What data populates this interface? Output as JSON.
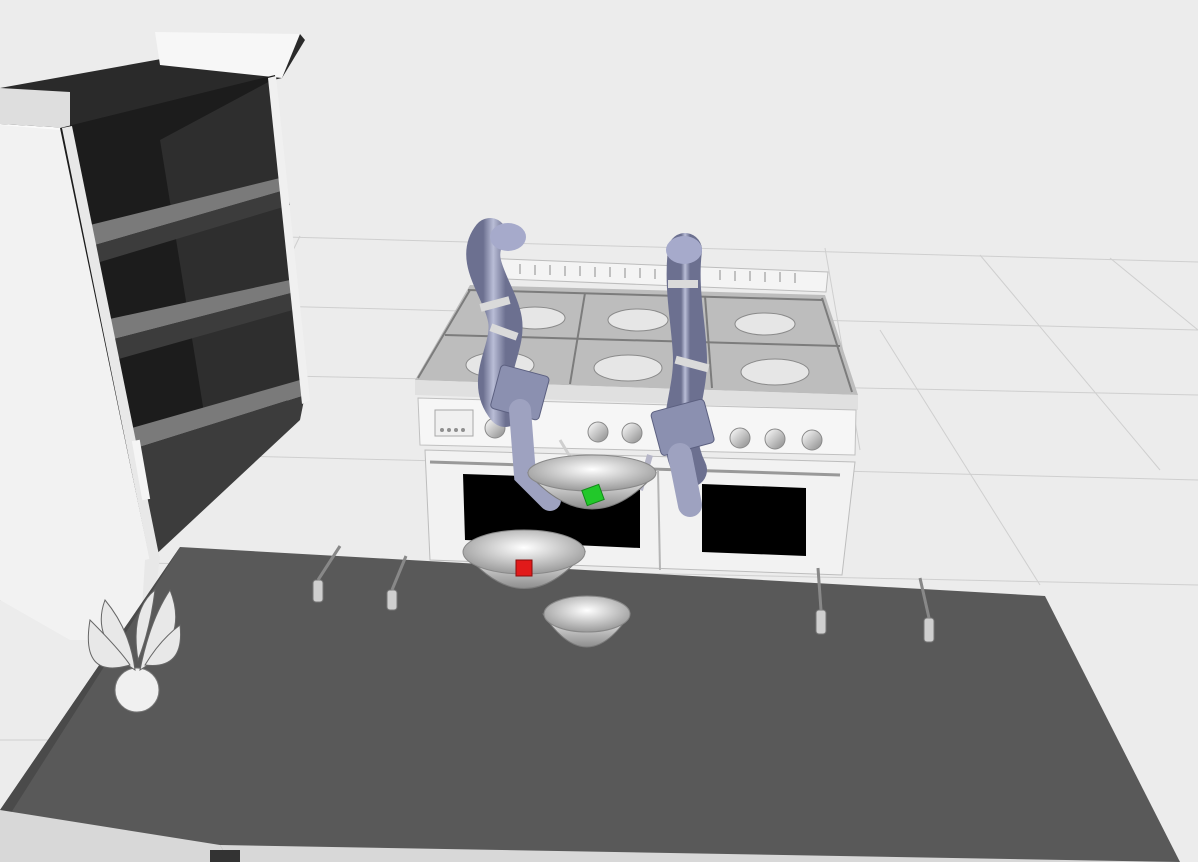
{
  "scene": {
    "background_color": "#ececec",
    "floor_grid": true,
    "objects": [
      {
        "name": "shelf-cabinet",
        "color": "#1e1e1e"
      },
      {
        "name": "stove",
        "color": "#f2f2f2"
      },
      {
        "name": "robot-arm-left",
        "color": "#8e93b4"
      },
      {
        "name": "robot-arm-right",
        "color": "#8e93b4"
      },
      {
        "name": "table",
        "color": "#595959"
      },
      {
        "name": "bowl-center",
        "contents": "green-cube"
      },
      {
        "name": "bowl-front-left",
        "contents": "red-cube"
      },
      {
        "name": "bowl-front-right",
        "contents": "empty"
      },
      {
        "name": "potted-plant",
        "color": "#e4e4e4"
      },
      {
        "name": "utensil-holders",
        "count": 4
      }
    ],
    "cube_colors": {
      "green": "#22c82a",
      "red": "#e11a1a"
    }
  }
}
